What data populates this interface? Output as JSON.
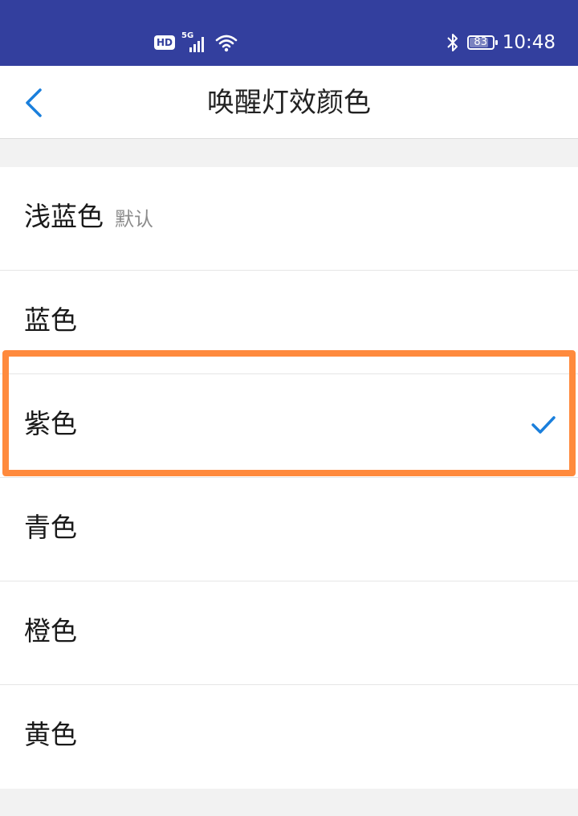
{
  "status_bar": {
    "hd": "HD",
    "network": "5G",
    "battery": "83",
    "battery_level": 0.83,
    "time": "10:48",
    "icons": [
      "hd-icon",
      "signal-icon",
      "wifi-icon",
      "bluetooth-icon",
      "battery-icon"
    ]
  },
  "header": {
    "title": "唤醒灯效颜色",
    "back_icon": "chevron-left-icon"
  },
  "options": [
    {
      "label": "浅蓝色",
      "note": "默认",
      "selected": false
    },
    {
      "label": "蓝色",
      "note": "",
      "selected": false
    },
    {
      "label": "紫色",
      "note": "",
      "selected": true
    },
    {
      "label": "青色",
      "note": "",
      "selected": false
    },
    {
      "label": "橙色",
      "note": "",
      "selected": false
    },
    {
      "label": "黄色",
      "note": "",
      "selected": false
    }
  ],
  "colors": {
    "status_bar_bg": "#333f9e",
    "accent": "#1a7fdc",
    "highlight": "#ff8a3d"
  }
}
